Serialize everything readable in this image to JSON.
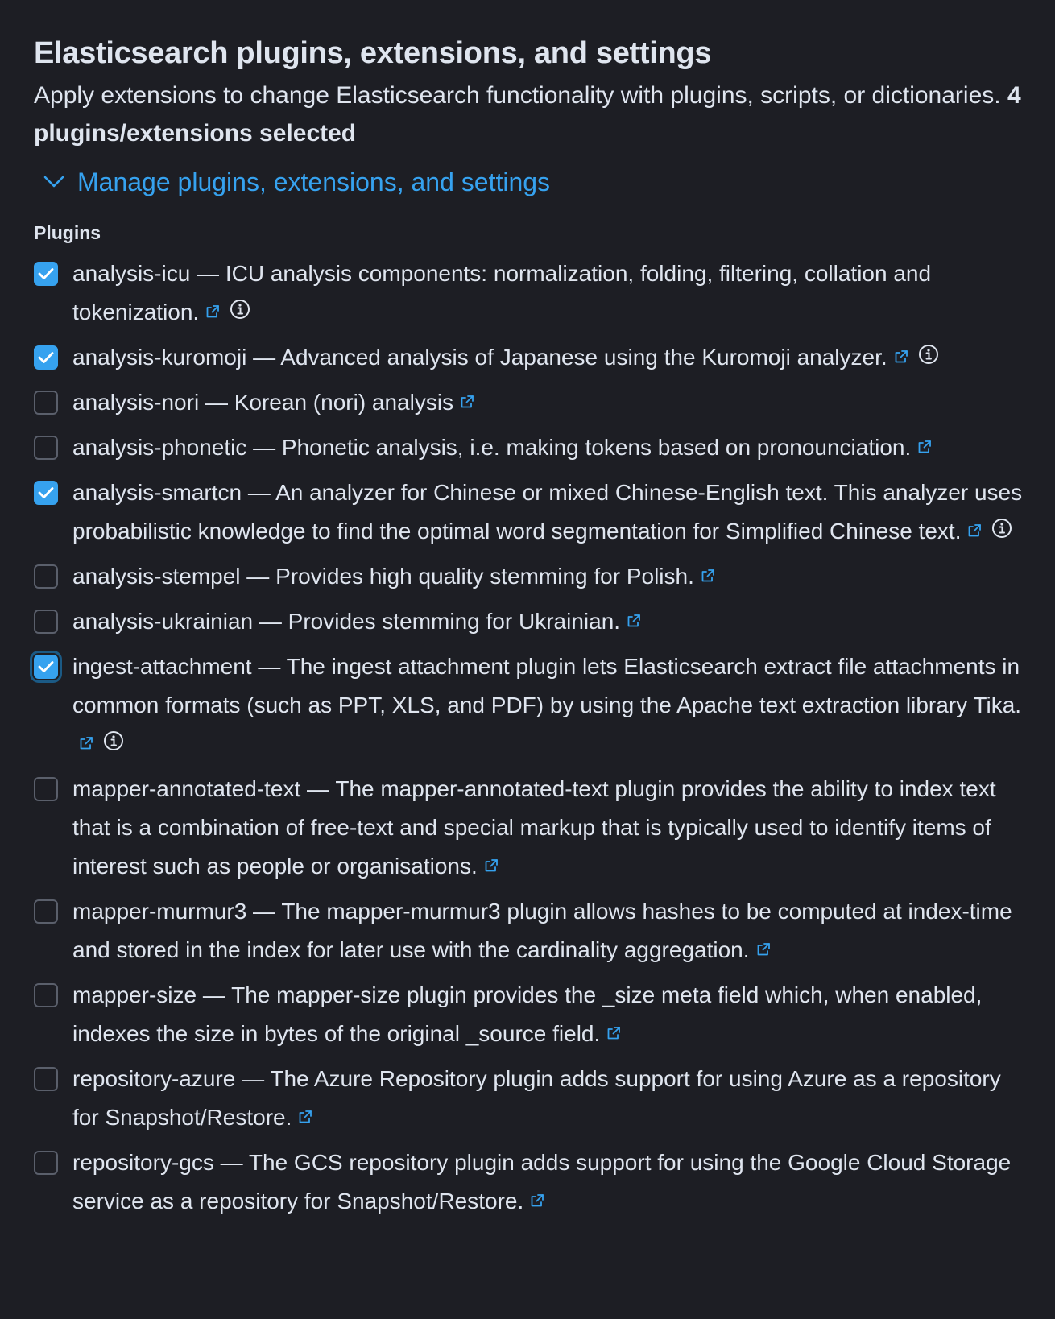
{
  "header": {
    "title": "Elasticsearch plugins, extensions, and settings",
    "description": "Apply extensions to change Elasticsearch functionality with plugins, scripts, or dictionaries.",
    "selected_count": "4 plugins/extensions selected"
  },
  "accordion": {
    "label": "Manage plugins, extensions, and settings",
    "expanded": true
  },
  "plugins": {
    "section_label": "Plugins",
    "items": [
      {
        "name": "analysis-icu",
        "text": "analysis-icu — ICU analysis components: normalization, folding, filtering, collation and tokenization.",
        "checked": true,
        "info": true
      },
      {
        "name": "analysis-kuromoji",
        "text": "analysis-kuromoji — Advanced analysis of Japanese using the Kuromoji analyzer.",
        "checked": true,
        "info": true
      },
      {
        "name": "analysis-nori",
        "text": "analysis-nori — Korean (nori) analysis",
        "checked": false,
        "info": false
      },
      {
        "name": "analysis-phonetic",
        "text": "analysis-phonetic — Phonetic analysis, i.e. making tokens based on pronounciation.",
        "checked": false,
        "info": false
      },
      {
        "name": "analysis-smartcn",
        "text": "analysis-smartcn — An analyzer for Chinese or mixed Chinese-English text. This analyzer uses probabilistic knowledge to find the optimal word segmentation for Simplified Chinese text.",
        "checked": true,
        "info": true
      },
      {
        "name": "analysis-stempel",
        "text": "analysis-stempel — Provides high quality stemming for Polish.",
        "checked": false,
        "info": false
      },
      {
        "name": "analysis-ukrainian",
        "text": "analysis-ukrainian — Provides stemming for Ukrainian.",
        "checked": false,
        "info": false
      },
      {
        "name": "ingest-attachment",
        "text": "ingest-attachment — The ingest attachment plugin lets Elasticsearch extract file attachments in common formats (such as PPT, XLS, and PDF) by using the Apache text extraction library Tika.",
        "checked": true,
        "info": true,
        "focused": true
      },
      {
        "name": "mapper-annotated-text",
        "text": "mapper-annotated-text — The mapper-annotated-text plugin provides the ability to index text that is a combination of free-text and special markup that is typically used to identify items of interest such as people or organisations.",
        "checked": false,
        "info": false
      },
      {
        "name": "mapper-murmur3",
        "text": "mapper-murmur3 — The mapper-murmur3 plugin allows hashes to be computed at index-time and stored in the index for later use with the cardinality aggregation.",
        "checked": false,
        "info": false
      },
      {
        "name": "mapper-size",
        "text": "mapper-size — The mapper-size plugin provides the _size meta field which, when enabled, indexes the size in bytes of the original _source field.",
        "checked": false,
        "info": false
      },
      {
        "name": "repository-azure",
        "text": "repository-azure — The Azure Repository plugin adds support for using Azure as a repository for Snapshot/Restore.",
        "checked": false,
        "info": false
      },
      {
        "name": "repository-gcs",
        "text": "repository-gcs — The GCS repository plugin adds support for using the Google Cloud Storage service as a repository for Snapshot/Restore.",
        "checked": false,
        "info": false
      }
    ]
  },
  "icons": {
    "chevron": "chevron-down-icon",
    "external": "external-link-icon",
    "info": "info-icon",
    "check": "check-icon"
  },
  "colors": {
    "background": "#1d1e24",
    "text": "#dfe5ef",
    "accent": "#36a2ef",
    "checkbox_border": "#5a5f6b"
  }
}
